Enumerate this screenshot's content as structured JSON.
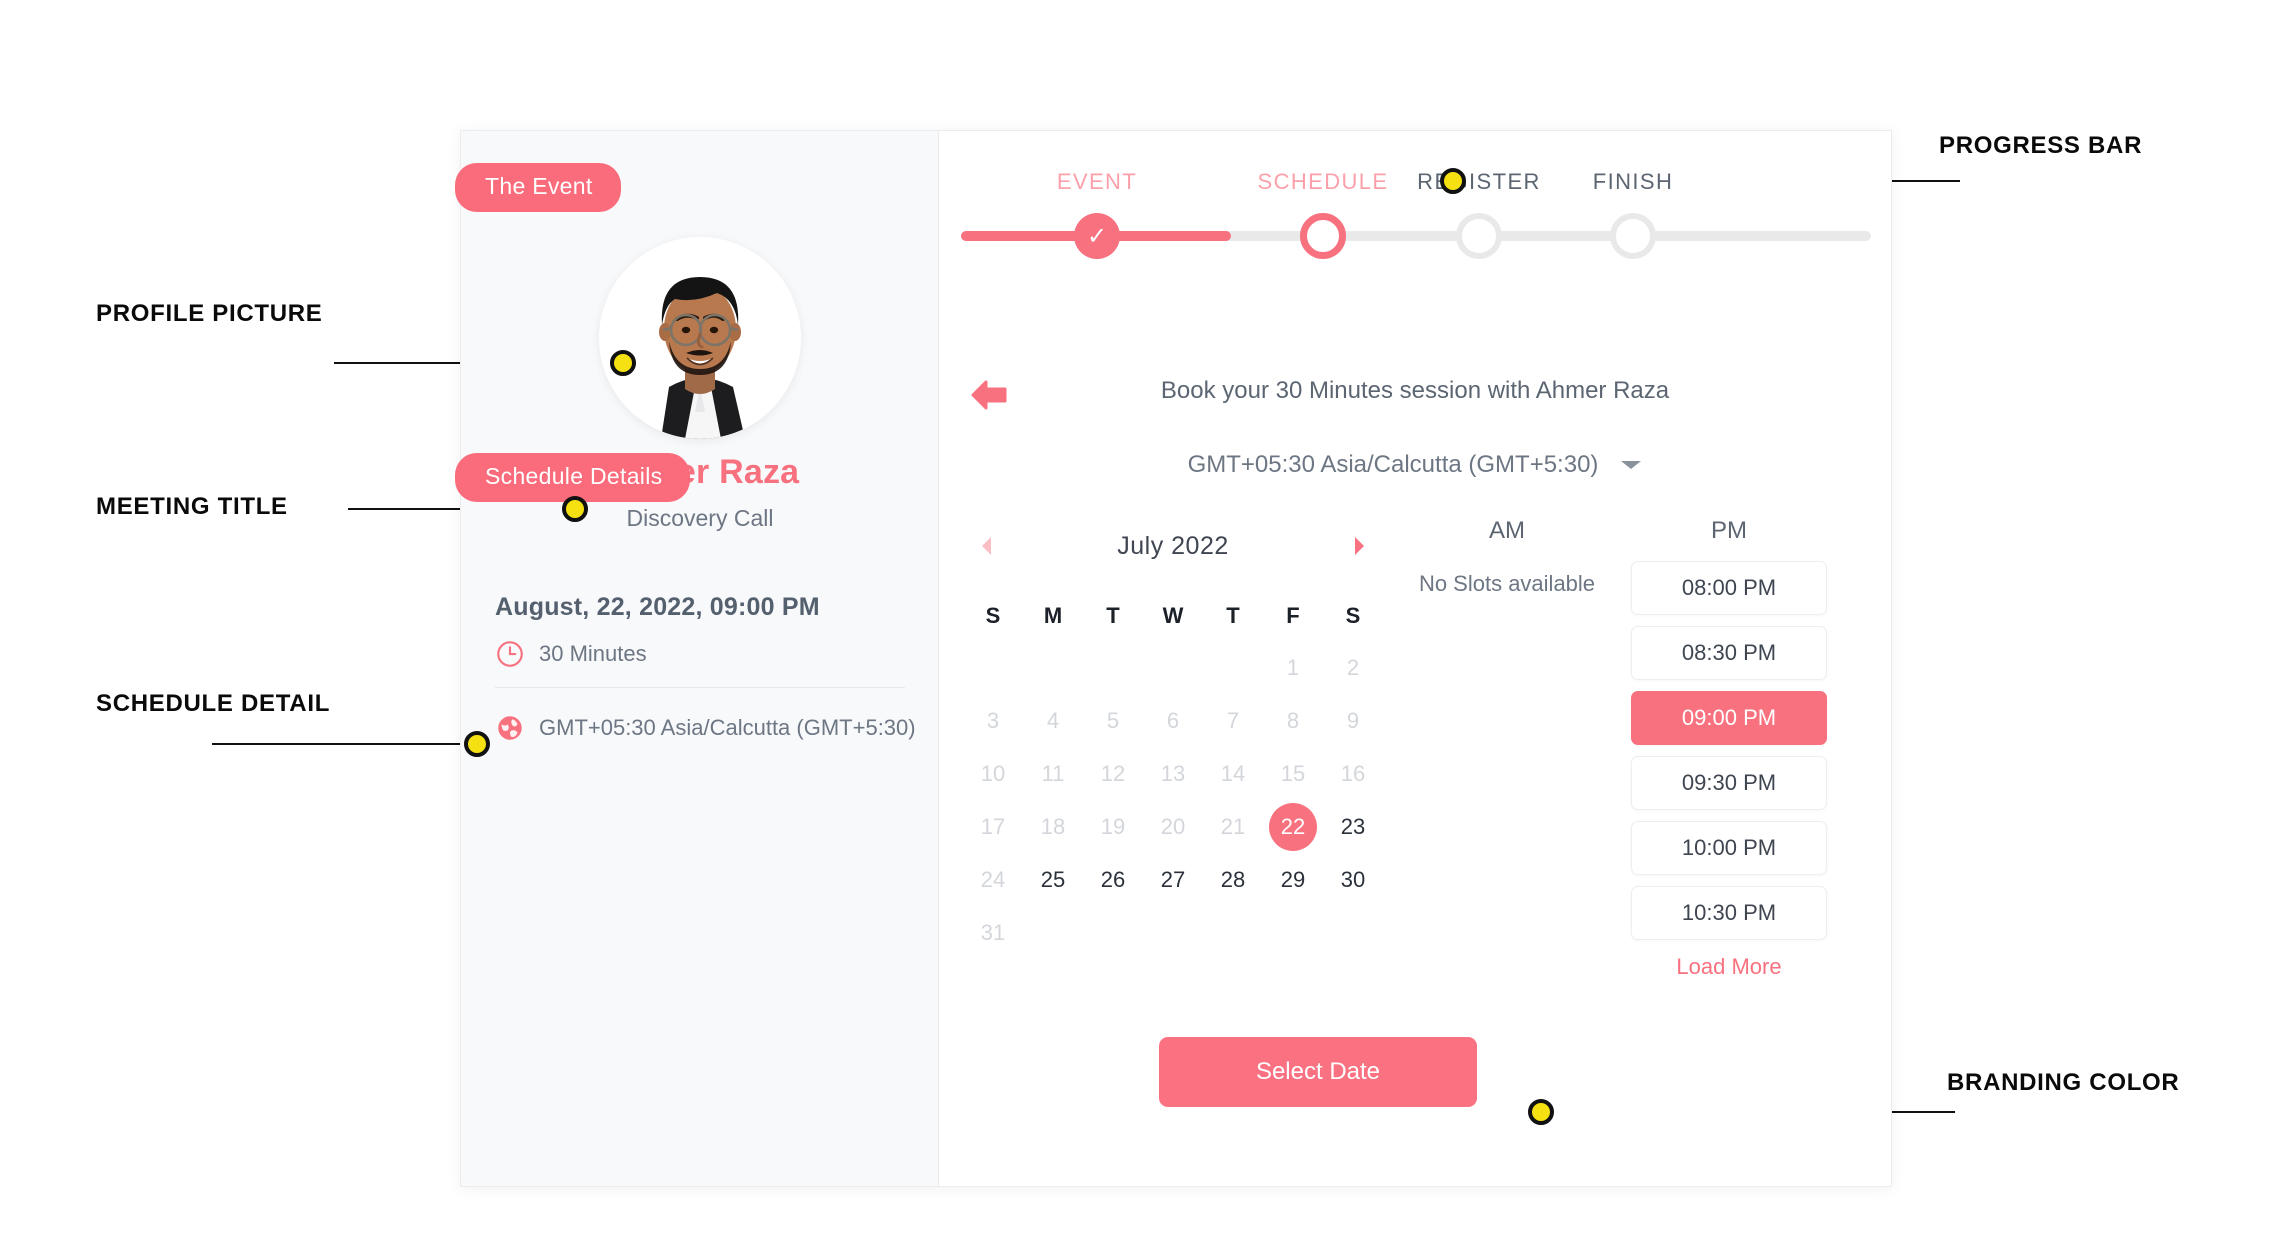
{
  "annotations": [
    {
      "label": "PROFILE PICTURE",
      "name": "annotation-profile-picture"
    },
    {
      "label": "MEETING TITLE",
      "name": "annotation-meeting-title"
    },
    {
      "label": "SCHEDULE DETAIL",
      "name": "annotation-schedule-detail"
    },
    {
      "label": "PROGRESS BAR",
      "name": "annotation-progress-bar"
    },
    {
      "label": "BRANDING COLOR",
      "name": "annotation-branding-color"
    }
  ],
  "colors": {
    "brand": "#fa7181",
    "brand_light": "#fba0aa",
    "selected_slot": "#f8717f",
    "callout_dot": "#f5e112",
    "sidebar_bg": "#f8f9fb",
    "track_inactive": "#e9e9e9"
  },
  "sidebar": {
    "event_pill": "The Event",
    "schedule_pill": "Schedule Details",
    "host_name": "Ahmer Raza",
    "host_subtitle": "Discovery Call",
    "schedule_datetime": "August, 22, 2022, 09:00 PM",
    "duration": "30 Minutes",
    "timezone": "GMT+05:30 Asia/Calcutta (GMT+5:30)",
    "clock_icon": "clock-icon",
    "globe_icon": "globe-icon"
  },
  "progress": {
    "steps": [
      {
        "label": "EVENT",
        "state": "done"
      },
      {
        "label": "SCHEDULE",
        "state": "current"
      },
      {
        "label": "REGISTER",
        "state": "todo"
      },
      {
        "label": "FINISH",
        "state": "todo"
      }
    ],
    "check_glyph": "✓"
  },
  "main": {
    "back_icon": "back-arrow-icon",
    "heading": "Book your 30 Minutes session with Ahmer Raza",
    "timezone_value": "GMT+05:30 Asia/Calcutta (GMT+5:30)",
    "timezone_caret": "chevron-down-icon",
    "select_date_button": "Select Date"
  },
  "calendar": {
    "month": "July",
    "year": "2022",
    "title": "July  2022",
    "prev_icon": "chevron-left-icon",
    "next_icon": "chevron-right-icon",
    "day_headers": [
      "S",
      "M",
      "T",
      "W",
      "T",
      "F",
      "S"
    ],
    "leading_blanks": 5,
    "days": [
      {
        "n": "1",
        "state": "muted"
      },
      {
        "n": "2",
        "state": "muted"
      },
      {
        "n": "3",
        "state": "muted"
      },
      {
        "n": "4",
        "state": "muted"
      },
      {
        "n": "5",
        "state": "muted"
      },
      {
        "n": "6",
        "state": "muted"
      },
      {
        "n": "7",
        "state": "muted"
      },
      {
        "n": "8",
        "state": "muted"
      },
      {
        "n": "9",
        "state": "muted"
      },
      {
        "n": "10",
        "state": "muted"
      },
      {
        "n": "11",
        "state": "muted"
      },
      {
        "n": "12",
        "state": "muted"
      },
      {
        "n": "13",
        "state": "muted"
      },
      {
        "n": "14",
        "state": "muted"
      },
      {
        "n": "15",
        "state": "muted"
      },
      {
        "n": "16",
        "state": "muted"
      },
      {
        "n": "17",
        "state": "muted"
      },
      {
        "n": "18",
        "state": "muted"
      },
      {
        "n": "19",
        "state": "muted"
      },
      {
        "n": "20",
        "state": "muted"
      },
      {
        "n": "21",
        "state": "muted"
      },
      {
        "n": "22",
        "state": "selected"
      },
      {
        "n": "23",
        "state": "enabled"
      },
      {
        "n": "24",
        "state": "muted"
      },
      {
        "n": "25",
        "state": "enabled"
      },
      {
        "n": "26",
        "state": "enabled"
      },
      {
        "n": "27",
        "state": "enabled"
      },
      {
        "n": "28",
        "state": "enabled"
      },
      {
        "n": "29",
        "state": "enabled"
      },
      {
        "n": "30",
        "state": "enabled"
      },
      {
        "n": "31",
        "state": "muted"
      }
    ]
  },
  "slots": {
    "am_header": "AM",
    "pm_header": "PM",
    "am_empty_text": "No Slots available",
    "am_times": [],
    "pm_times": [
      {
        "time": "08:00 PM",
        "selected": false
      },
      {
        "time": "08:30 PM",
        "selected": false
      },
      {
        "time": "09:00 PM",
        "selected": true
      },
      {
        "time": "09:30 PM",
        "selected": false
      },
      {
        "time": "10:00 PM",
        "selected": false
      },
      {
        "time": "10:30 PM",
        "selected": false
      }
    ],
    "load_more": "Load More"
  }
}
